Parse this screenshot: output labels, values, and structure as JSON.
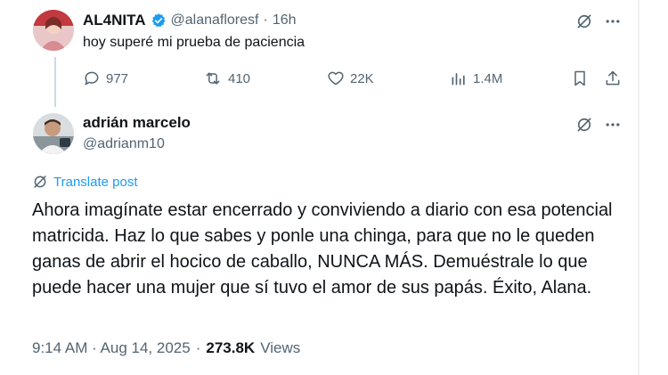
{
  "first_tweet": {
    "display_name": "AL4NITA",
    "handle": "@alanafloresf",
    "separator": "·",
    "time": "16h",
    "text": "hoy superé mi prueba de paciencia",
    "actions": {
      "replies": "977",
      "reposts": "410",
      "likes": "22K",
      "views": "1.4M"
    },
    "icons": [
      "grok-icon",
      "more-icon",
      "reply-icon",
      "repost-icon",
      "like-icon",
      "views-icon",
      "bookmark-icon",
      "share-icon"
    ],
    "verified_color": "#1d9bf0"
  },
  "reply_tweet": {
    "display_name": "adrián marcelo",
    "handle": "@adrianm10",
    "translate_label": "Translate post",
    "text": "Ahora imagínate estar encerrado y conviviendo a diario con esa potencial matricida. Haz lo que sabes y ponle una chinga, para que no le queden ganas de abrir el hocico de caballo, NUNCA MÁS. Demuéstrale lo que puede hacer una mujer que sí tuvo el amor de sus papás. Éxito, Alana.",
    "timestamp": "9:14 AM · Aug 14, 2025",
    "meta_separator": "·",
    "views_count": "273.8K",
    "views_label": "Views"
  },
  "colors": {
    "text": "#0f1419",
    "muted": "#536471",
    "link": "#1d9bf0"
  }
}
